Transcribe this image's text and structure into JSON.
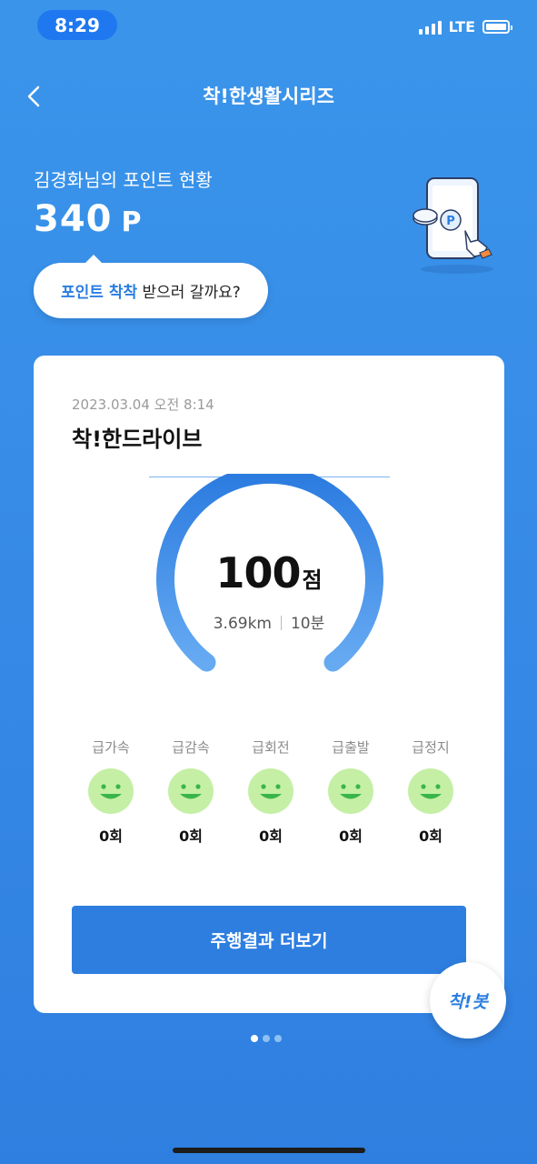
{
  "status_bar": {
    "time": "8:29",
    "network": "LTE"
  },
  "header": {
    "title": "착!한생활시리즈",
    "back_icon": "chevron-left-icon"
  },
  "points": {
    "label": "김경화님의 포인트 현황",
    "value": "340",
    "unit": "P"
  },
  "illustration": {
    "coin_label": "P"
  },
  "bubble": {
    "highlight": "포인트 착착",
    "rest": " 받으러 갈까요?"
  },
  "card": {
    "date": "2023.03.04 오전 8:14",
    "title": "착!한드라이브",
    "score": "100",
    "score_unit": "점",
    "distance": "3.69km",
    "duration": "10분",
    "events": [
      {
        "label": "급가속",
        "count": "0회",
        "icon": "smiley-face-icon"
      },
      {
        "label": "급감속",
        "count": "0회",
        "icon": "smiley-face-icon"
      },
      {
        "label": "급회전",
        "count": "0회",
        "icon": "smiley-face-icon"
      },
      {
        "label": "급출발",
        "count": "0회",
        "icon": "smiley-face-icon"
      },
      {
        "label": "급정지",
        "count": "0회",
        "icon": "smiley-face-icon"
      }
    ],
    "more_button": "주행결과 더보기"
  },
  "fab": {
    "label": "착!봇"
  },
  "pager": {
    "total": 3,
    "active": 1
  },
  "colors": {
    "accent": "#2e7ee0",
    "background": "#3a8fe8",
    "face": "#c6efa6",
    "face_features": "#39b54a"
  }
}
